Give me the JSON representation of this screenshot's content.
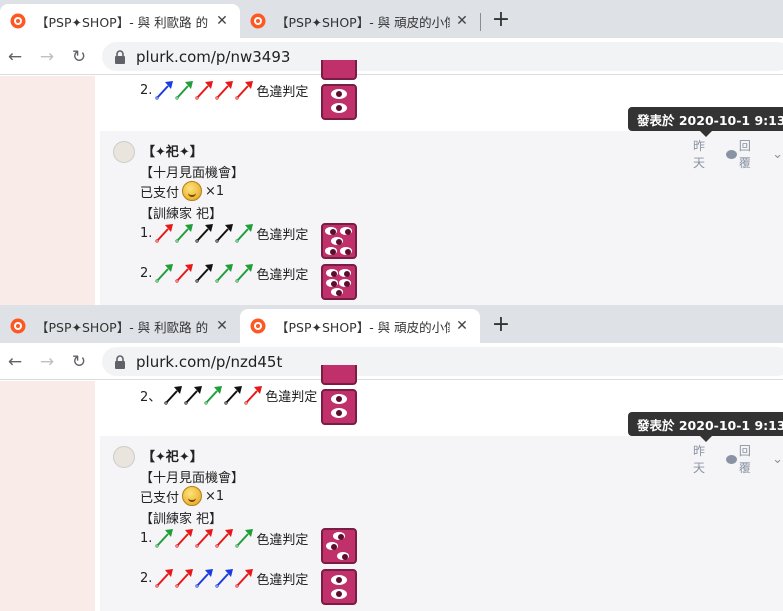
{
  "windows": [
    {
      "tabs": [
        {
          "title": "【PSP✦SHOP】- 與 利歐路 的 手",
          "active": true
        },
        {
          "title": "【PSP✦SHOP】- 與 頑皮的小傢",
          "active": false
        }
      ],
      "url": "plurk.com/p/nw3493",
      "prev_line": {
        "label": "2.",
        "arrows": [
          "blue",
          "green",
          "red",
          "red",
          "red"
        ],
        "suffix": "色違判定"
      },
      "tooltip": "發表於 2020-10-1 9:13",
      "post": {
        "author": "【✦祀✦】",
        "lines": [
          "【十月見面機會】",
          "已支付",
          "×1",
          "【訓練家 祀】"
        ],
        "rows": [
          {
            "label": "1.",
            "arrows": [
              "red",
              "green",
              "black",
              "black",
              "green"
            ],
            "suffix": "色違判定"
          },
          {
            "label": "2.",
            "arrows": [
              "green",
              "red",
              "black",
              "green",
              "green"
            ],
            "suffix": "色違判定"
          }
        ],
        "time": "昨天",
        "reply": "回覆"
      }
    },
    {
      "tabs": [
        {
          "title": "【PSP✦SHOP】- 與 利歐路 的 手",
          "active": false
        },
        {
          "title": "【PSP✦SHOP】- 與 頑皮的小傢",
          "active": true
        }
      ],
      "url": "plurk.com/p/nzd45t",
      "prev_line": {
        "label": "2、",
        "arrows": [
          "black",
          "black",
          "green",
          "black",
          "red"
        ],
        "suffix": "色違判定"
      },
      "tooltip": "發表於 2020-10-1 9:13",
      "post": {
        "author": "【✦祀✦】",
        "lines": [
          "【十月見面機會】",
          "已支付",
          "×1",
          "【訓練家 祀】"
        ],
        "rows": [
          {
            "label": "1.",
            "arrows": [
              "green",
              "red",
              "red",
              "red",
              "green"
            ],
            "suffix": "色違判定"
          },
          {
            "label": "2.",
            "arrows": [
              "red",
              "red",
              "blue",
              "blue",
              "red"
            ],
            "suffix": "色違判定"
          }
        ],
        "time": "昨天",
        "reply": "回覆"
      }
    }
  ],
  "icons": {
    "favicon": "plurk-favicon-icon",
    "close": "close-icon",
    "new_tab": "plus-icon",
    "back": "arrow-left-icon",
    "forward": "arrow-right-icon",
    "reload": "reload-icon",
    "lock": "lock-icon",
    "coin": "coin-emoticon-icon",
    "avatar": "user-avatar-icon",
    "stamp": "eye-stamp-icon",
    "chevron": "chevron-down-icon",
    "arrow_marker": "arrow-pin-icon"
  },
  "colors": {
    "red": "#e81818",
    "green": "#1f9e3a",
    "blue": "#1b3ce0",
    "black": "#111111",
    "stamp": "#c0306a"
  }
}
